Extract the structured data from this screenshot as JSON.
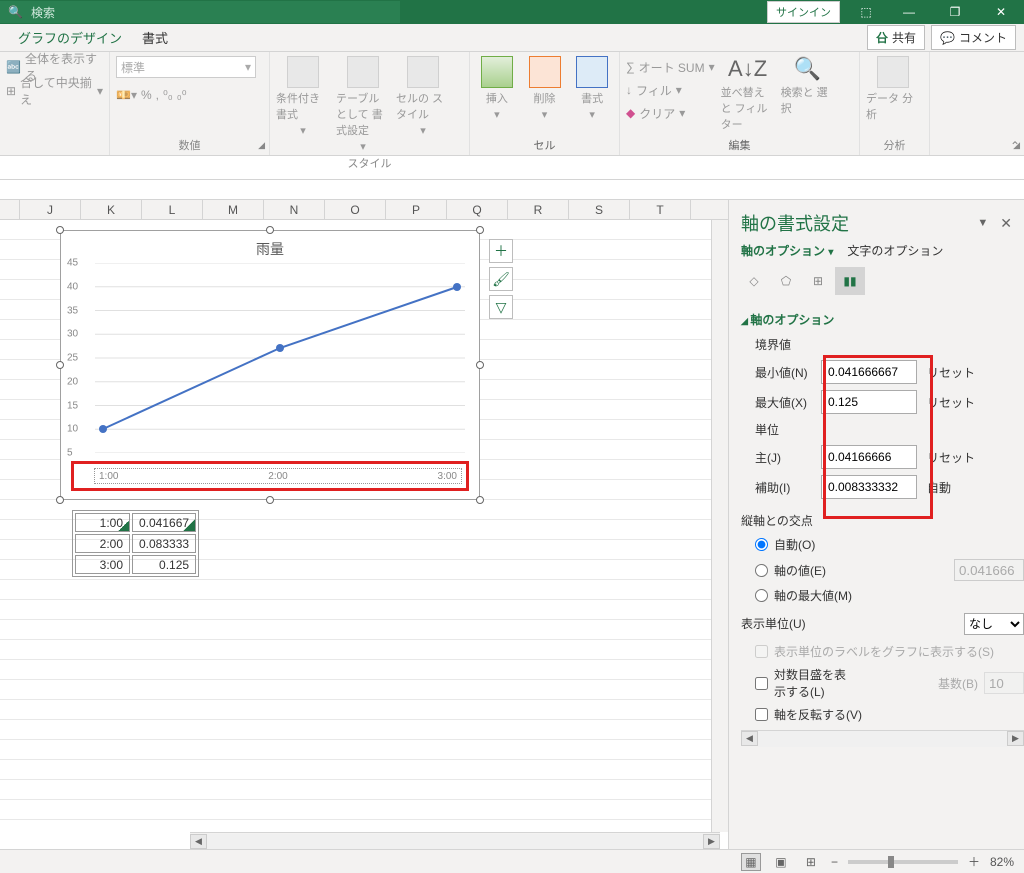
{
  "titlebar": {
    "search_placeholder": "検索",
    "signin": "サインイン"
  },
  "tabs": {
    "design": "グラフのデザイン",
    "format": "書式",
    "share": "共有",
    "comment": "コメント"
  },
  "ribbon": {
    "alignment": {
      "wrap": "全体を表示する",
      "merge": "合して中央揃え"
    },
    "number": {
      "label": "数値",
      "format": "標準"
    },
    "styles": {
      "label": "スタイル",
      "cond": "条件付き\n書式",
      "table": "テーブルとして\n書式設定",
      "cell": "セルの\nスタイル"
    },
    "cells": {
      "label": "セル",
      "insert": "挿入",
      "delete": "削除",
      "format": "書式"
    },
    "editing": {
      "label": "編集",
      "autosum": "オート SUM",
      "fill": "フィル",
      "clear": "クリア",
      "sort": "並べ替えと\nフィルター",
      "find": "検索と\n選択"
    },
    "analysis": {
      "label": "分析",
      "data": "データ\n分析"
    }
  },
  "columns": [
    "J",
    "K",
    "L",
    "M",
    "N",
    "O",
    "P",
    "Q",
    "R",
    "S",
    "T"
  ],
  "chart": {
    "title": "雨量",
    "x_labels": [
      "1:00",
      "2:00",
      "3:00"
    ],
    "y_ticks": [
      5,
      10,
      15,
      20,
      25,
      30,
      35,
      40,
      45
    ]
  },
  "chart_data": {
    "type": "line",
    "title": "雨量",
    "categories": [
      "1:00",
      "2:00",
      "3:00"
    ],
    "values": [
      10,
      27,
      40
    ],
    "ylim": [
      5,
      45
    ]
  },
  "data_table": [
    {
      "time": "1:00",
      "val": "0.041667"
    },
    {
      "time": "2:00",
      "val": "0.083333"
    },
    {
      "time": "3:00",
      "val": "0.125"
    }
  ],
  "panel": {
    "title": "軸の書式設定",
    "tab_axis": "軸のオプション",
    "tab_text": "文字のオプション",
    "section_axis": "軸のオプション",
    "bounds": "境界値",
    "min_l": "最小値(N)",
    "min_v": "0.041666667",
    "max_l": "最大値(X)",
    "max_v": "0.125",
    "reset": "リセット",
    "units": "単位",
    "major_l": "主(J)",
    "major_v": "0.04166666",
    "minor_l": "補助(I)",
    "minor_v": "0.008333332",
    "auto": "自動",
    "cross": "縦軸との交点",
    "cross_auto": "自動(O)",
    "cross_val": "軸の値(E)",
    "cross_val_v": "0.041666",
    "cross_max": "軸の最大値(M)",
    "disp_unit": "表示単位(U)",
    "disp_unit_v": "なし",
    "disp_unit_chk": "表示単位のラベルをグラフに表示する(S)",
    "log_l": "対数目盛を表\n示する(L)",
    "log_base_l": "基数(B)",
    "log_base_v": "10",
    "reverse": "軸を反転する(V)"
  },
  "status": {
    "zoom": "82%"
  }
}
